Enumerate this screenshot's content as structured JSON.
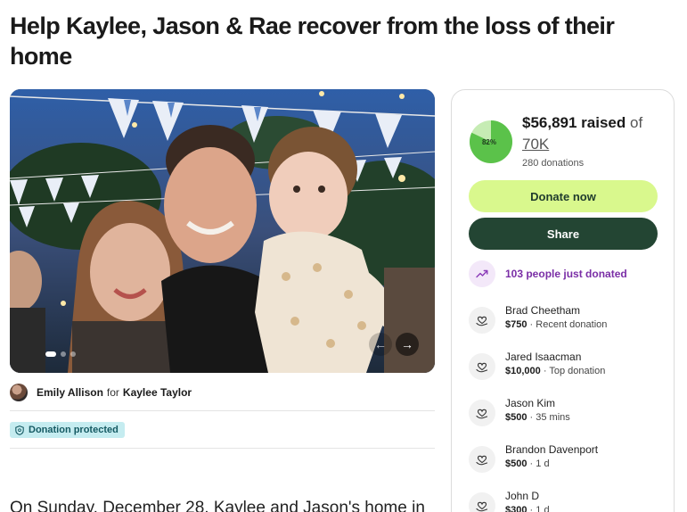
{
  "page": {
    "title": "Help Kaylee, Jason & Rae recover from the loss of their home",
    "story_start": "On Sunday, December 28, Kaylee and Jason's home in"
  },
  "organizer": {
    "name": "Emily Allison",
    "for_text": "for",
    "beneficiary": "Kaylee Taylor"
  },
  "badge": {
    "label": "Donation protected"
  },
  "carousel": {
    "prev_icon": "arrow-left-icon",
    "next_icon": "arrow-right-icon",
    "prev_glyph": "←",
    "next_glyph": "→",
    "slide_count": 3,
    "active_slide": 1
  },
  "fundraiser": {
    "progress_percent": 82,
    "progress_label": "82%",
    "raised_amount": "$56,891 raised",
    "of_text": "of",
    "goal": "70K",
    "donation_count": "280 donations",
    "donate_label": "Donate now",
    "share_label": "Share",
    "trend_text": "103 people just donated",
    "colors": {
      "progress_fill": "#5bc24a",
      "progress_track": "#c6ecb4",
      "donate_bg": "#d9f88d",
      "share_bg": "#234533",
      "trend_text": "#7a2ea6"
    }
  },
  "donors": [
    {
      "name": "Brad Cheetham",
      "amount": "$750",
      "detail": "Recent donation"
    },
    {
      "name": "Jared Isaacman",
      "amount": "$10,000",
      "detail": "Top donation"
    },
    {
      "name": "Jason Kim",
      "amount": "$500",
      "detail": "35 mins"
    },
    {
      "name": "Brandon Davenport",
      "amount": "$500",
      "detail": "1 d"
    },
    {
      "name": "John D",
      "amount": "$300",
      "detail": "1 d"
    }
  ]
}
